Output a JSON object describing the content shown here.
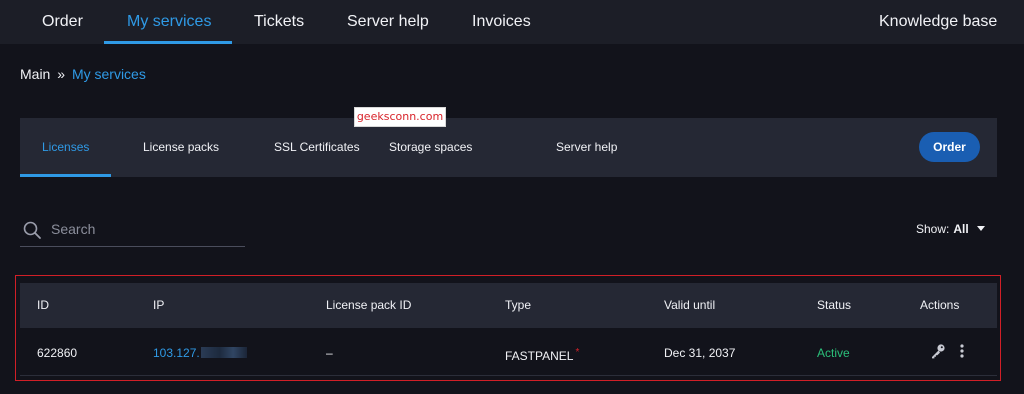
{
  "topnav": {
    "items": [
      "Order",
      "My services",
      "Tickets",
      "Server help",
      "Invoices"
    ],
    "right_link": "Knowledge base",
    "active_index": 1
  },
  "breadcrumb": {
    "home": "Main",
    "separator": "»",
    "current": "My services"
  },
  "watermark": "geeksconn.com",
  "subnav": {
    "tabs": [
      "Licenses",
      "License packs",
      "SSL Certificates",
      "Storage spaces",
      "Server help"
    ],
    "active_index": 0,
    "order_button": "Order"
  },
  "search": {
    "placeholder": "Search",
    "value": ""
  },
  "filter": {
    "label": "Show:",
    "value": "All"
  },
  "table": {
    "columns": [
      "ID",
      "IP",
      "License pack ID",
      "Type",
      "Valid until",
      "Status",
      "Actions"
    ],
    "rows": [
      {
        "id": "622860",
        "ip": "103.127.",
        "ip_redacted": true,
        "license_pack_id": "–",
        "type": "FASTPANEL",
        "type_marker": "*",
        "valid_until": "Dec 31, 2037",
        "status": "Active",
        "actions": [
          "key-icon",
          "more-vertical-icon"
        ]
      }
    ]
  },
  "colors": {
    "background": "#12131b",
    "nav_bar": "#1c1e27",
    "panel": "#252834",
    "accent": "#2f9ae6",
    "button": "#1a5eb2",
    "status_active": "#2bc07a",
    "highlight_border": "#d11f27"
  }
}
